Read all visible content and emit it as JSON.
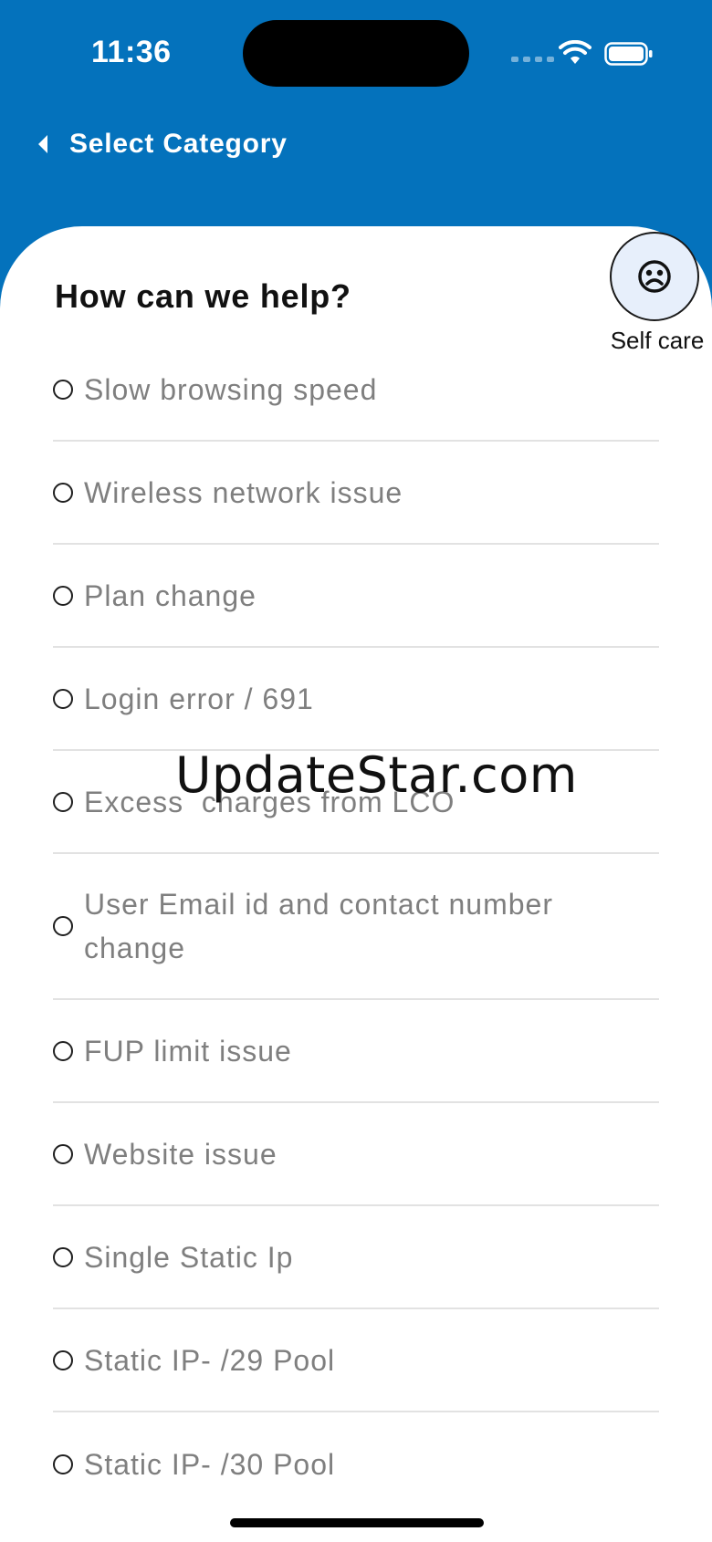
{
  "status_bar": {
    "time": "11:36",
    "icons": [
      "cellular-signal-icon",
      "wifi-icon",
      "battery-icon"
    ]
  },
  "nav": {
    "back_icon": "chevron-left-icon",
    "title": "Select Category"
  },
  "main": {
    "heading": "How can we help?",
    "self_care": {
      "icon": "self-care-face-icon",
      "label": "Self care"
    },
    "options": [
      "Slow browsing speed",
      "Wireless network issue",
      "Plan change",
      "Login error / 691",
      "Excess  charges from LCO",
      "User Email id and contact number change",
      "FUP limit issue",
      "Website issue",
      "Single Static Ip",
      "Static IP- /29 Pool",
      "Static IP- /30 Pool"
    ]
  },
  "watermark": "UpdateStar.com",
  "colors": {
    "header_blue": "#0472bc",
    "option_text": "#7f7f7f",
    "self_care_bg": "#e7effb"
  }
}
